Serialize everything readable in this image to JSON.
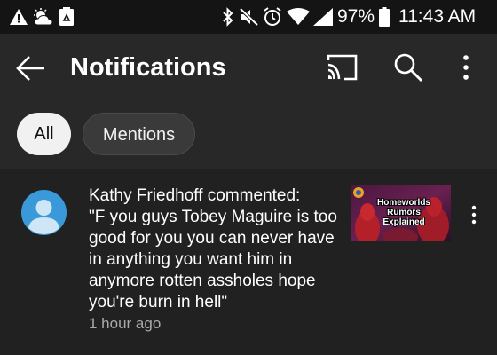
{
  "status_bar": {
    "icons_left": [
      "warning-icon",
      "weather-icon",
      "recycle-icon"
    ],
    "icons_right": [
      "bluetooth-icon",
      "mute-icon",
      "alarm-icon",
      "wifi-icon",
      "signal-icon",
      "battery-icon"
    ],
    "battery_percent": "97%",
    "time": "11:43 AM"
  },
  "header": {
    "title": "Notifications",
    "icons": [
      "back-arrow-icon",
      "cast-icon",
      "search-icon",
      "more-vert-icon"
    ]
  },
  "filters": [
    {
      "label": "All",
      "selected": true
    },
    {
      "label": "Mentions",
      "selected": false
    }
  ],
  "notifications": [
    {
      "author": "Kathy Friedhoff commented:",
      "message": "\"F you guys Tobey Maguire is too good for you you can never have in anything you want him in anymore rotten assholes hope you're burn in hell\"",
      "time": "1 hour ago",
      "thumbnail_text": "Homeworlds Rumors Explained"
    }
  ],
  "colors": {
    "background": "#212121",
    "app_bar": "#282828",
    "status_bar": "#141414",
    "chip_selected": "#f1f1f1",
    "chip_unselected": "#3a3a3a",
    "avatar": "#3a9ad9",
    "secondary_text": "#aaaaaa"
  }
}
